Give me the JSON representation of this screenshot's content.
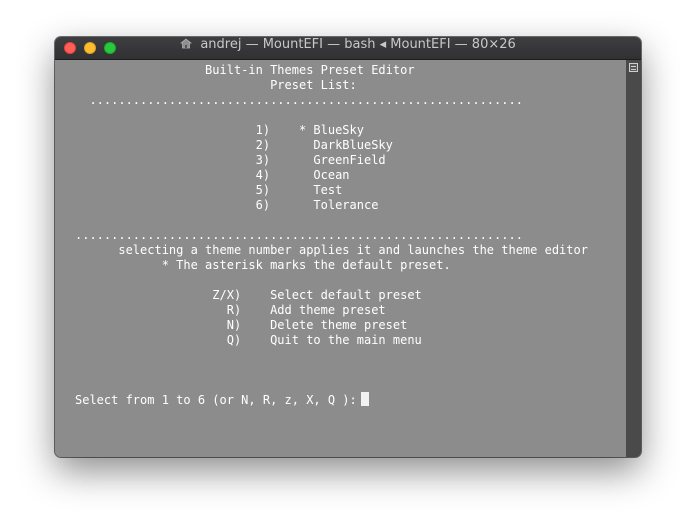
{
  "window": {
    "title": "andrej — MountEFI — bash ◂ MountEFI — 80×26",
    "buttons": {
      "close": "close",
      "minimize": "minimize",
      "zoom": "zoom"
    }
  },
  "terminal": {
    "lines": [
      "                  Built-in Themes Preset Editor",
      "                           Preset List:",
      "  ............................................................",
      "",
      "                         1)    * BlueSky",
      "                         2)      DarkBlueSky",
      "                         3)      GreenField",
      "                         4)      Ocean",
      "                         5)      Test",
      "                         6)      Tolerance",
      "",
      "..............................................................",
      "      selecting a theme number applies it and launches the theme editor",
      "            * The asterisk marks the default preset.",
      "",
      "                   Z/X)    Select default preset",
      "                     R)    Add theme preset",
      "                     N)    Delete theme preset",
      "                     Q)    Quit to the main menu",
      "",
      "",
      "",
      "Select from 1 to 6 (or N, R, z, X, Q ):"
    ]
  },
  "icons": {
    "home": "home-icon",
    "scroll": "scroll-split-icon"
  }
}
